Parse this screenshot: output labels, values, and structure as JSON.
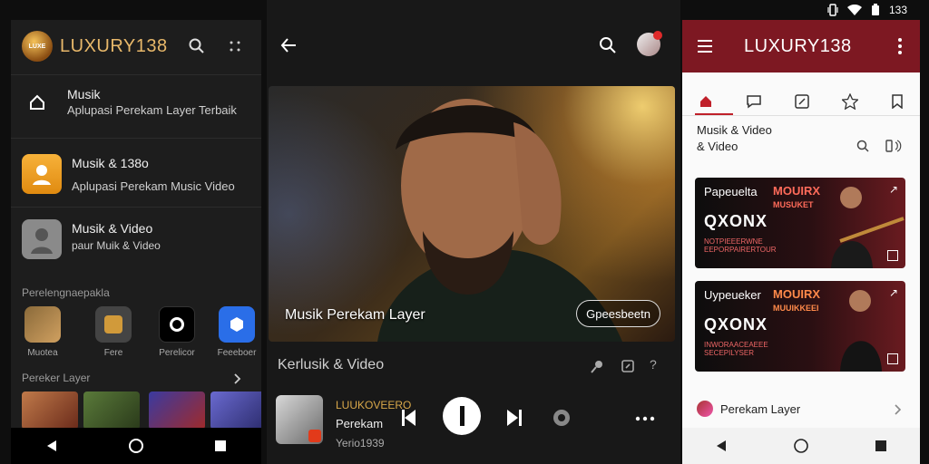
{
  "status_bar": {
    "time": "133"
  },
  "left": {
    "brand": "LUXURY138",
    "logo_text": "LUXE",
    "home_item": {
      "title": "Musik",
      "subtitle": "Aplupasi Perekam Layer Terbaik"
    },
    "list": [
      {
        "title": "Musik & 138o",
        "subtitle": "Aplupasi Perekam Music Video"
      },
      {
        "title": "Musik & Video",
        "subtitle": "paur Muik & Video"
      }
    ],
    "section1": "Perelengnaepakla",
    "apps": [
      "Muotea",
      "Fere",
      "Perelicor",
      "Feeeboer"
    ],
    "section2": "Pereker Layer"
  },
  "mid": {
    "hero_caption": "Musik Perekam Layer",
    "hero_button": "Gpeesbeetn",
    "section_title": "Kerlusik & Video",
    "now_playing": {
      "title": "LUUKOVEERO",
      "artist": "Perekam",
      "sub": "Yerio1939"
    }
  },
  "right": {
    "brand": "LUXURY138",
    "heading_line1": "Musik & Video",
    "heading_line2": "& Video",
    "cards": [
      {
        "title": "Papeuelta",
        "red1": "MOUIRX",
        "red2": "MUSUKET",
        "big": "QXONX",
        "sub": "NOTPIEEERWNE EEPORPAIRERTOUR"
      },
      {
        "title": "Uypeueker",
        "red1": "MOUIRX",
        "red2": "MUUIKKEEI",
        "big": "QXONX",
        "sub": "INWORAACEAEEE SECEPILYSER"
      }
    ],
    "footer_item": "Perekam Layer"
  }
}
